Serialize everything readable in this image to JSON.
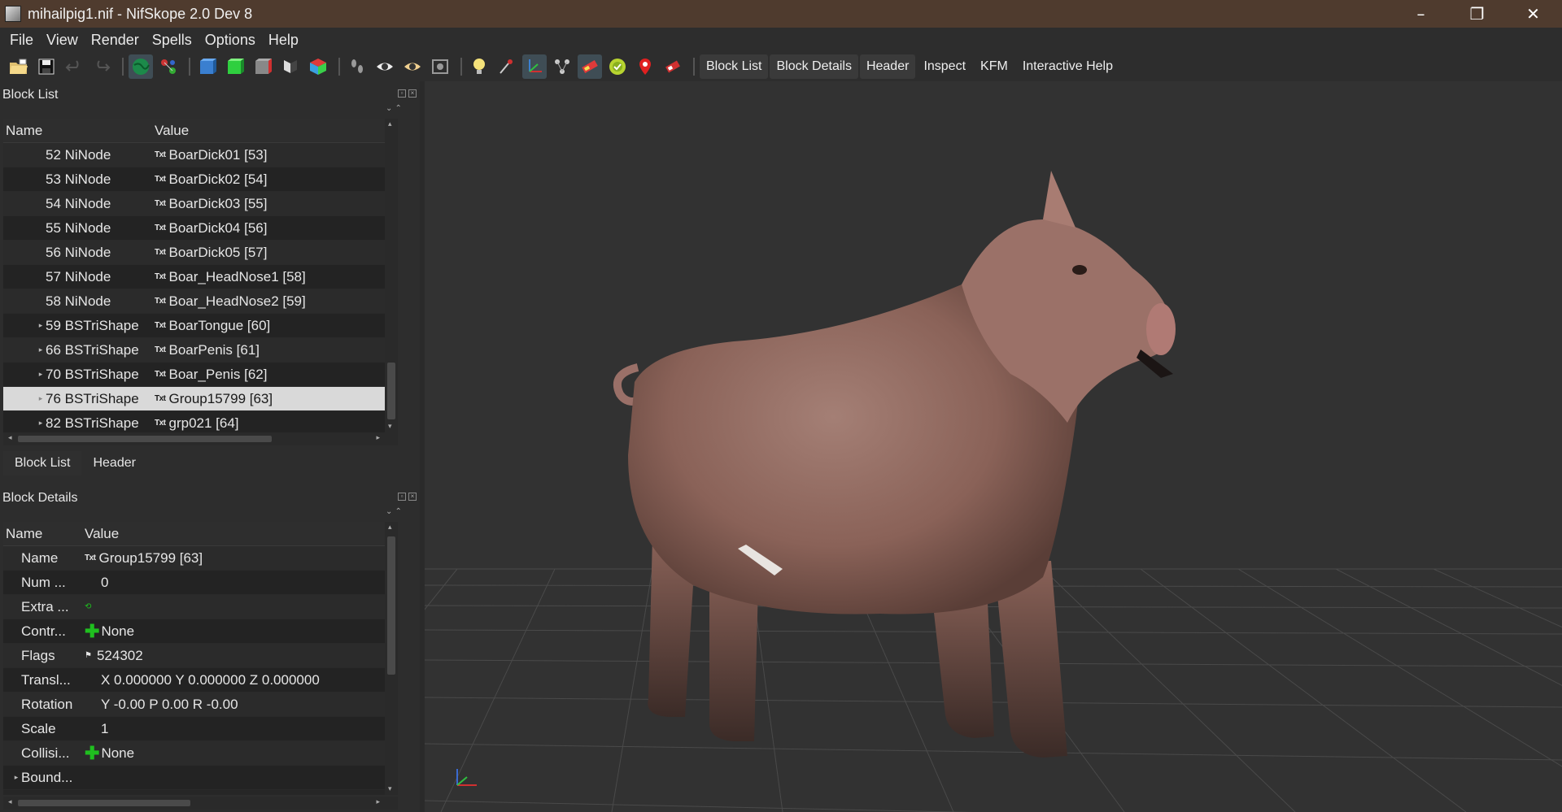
{
  "window": {
    "title": "mihailpig1.nif - NifSkope 2.0 Dev 8",
    "controls": [
      "–",
      "❐",
      "✕"
    ]
  },
  "menu": [
    "File",
    "View",
    "Render",
    "Spells",
    "Options",
    "Help"
  ],
  "toolbar": {
    "text_buttons": [
      "Block List",
      "Block Details",
      "Header",
      "Inspect",
      "KFM",
      "Interactive Help"
    ]
  },
  "block_list": {
    "title": "Block List",
    "columns": [
      "Name",
      "Value"
    ],
    "rows": [
      {
        "expander": "",
        "name": "52 NiNode",
        "value": "BoarDick01 [53]"
      },
      {
        "expander": "",
        "name": "53 NiNode",
        "value": "BoarDick02 [54]"
      },
      {
        "expander": "",
        "name": "54 NiNode",
        "value": "BoarDick03 [55]"
      },
      {
        "expander": "",
        "name": "55 NiNode",
        "value": "BoarDick04 [56]"
      },
      {
        "expander": "",
        "name": "56 NiNode",
        "value": "BoarDick05 [57]"
      },
      {
        "expander": "",
        "name": "57 NiNode",
        "value": "Boar_HeadNose1 [58]"
      },
      {
        "expander": "",
        "name": "58 NiNode",
        "value": "Boar_HeadNose2 [59]"
      },
      {
        "expander": "▸",
        "name": "59 BSTriShape",
        "value": "BoarTongue [60]"
      },
      {
        "expander": "▸",
        "name": "66 BSTriShape",
        "value": "BoarPenis [61]"
      },
      {
        "expander": "▸",
        "name": "70 BSTriShape",
        "value": "Boar_Penis [62]"
      },
      {
        "expander": "▸",
        "name": "76 BSTriShape",
        "value": "Group15799 [63]",
        "selected": true
      },
      {
        "expander": "▸",
        "name": "82 BSTriShape",
        "value": "grp021 [64]"
      }
    ],
    "tabs": [
      "Block List",
      "Header"
    ]
  },
  "block_details": {
    "title": "Block Details",
    "columns": [
      "Name",
      "Value"
    ],
    "rows": [
      {
        "expander": "",
        "name": "Name",
        "icon": "Txt",
        "value": "Group15799 [63]"
      },
      {
        "expander": "",
        "name": "Num ...",
        "icon": "",
        "value": "0"
      },
      {
        "expander": "",
        "name": "Extra ...",
        "icon": "link",
        "value": ""
      },
      {
        "expander": "",
        "name": "Contr...",
        "icon": "plus",
        "value": "None"
      },
      {
        "expander": "",
        "name": "Flags",
        "icon": "flag",
        "value": "524302"
      },
      {
        "expander": "",
        "name": "Transl...",
        "icon": "",
        "value": "X 0.000000 Y 0.000000 Z 0.000000"
      },
      {
        "expander": "",
        "name": "Rotation",
        "icon": "",
        "value": "Y -0.00 P 0.00 R -0.00"
      },
      {
        "expander": "",
        "name": "Scale",
        "icon": "",
        "value": "1"
      },
      {
        "expander": "",
        "name": "Collisi...",
        "icon": "plus",
        "value": "None"
      },
      {
        "expander": "▸",
        "name": "Bound...",
        "icon": "",
        "value": ""
      }
    ]
  },
  "icons": {
    "txt": "Txt",
    "plus_color": "#1fbf1f"
  },
  "viewport": {
    "background": "#323232",
    "grid_color": "#4a4a4a",
    "model": "pig-model"
  }
}
